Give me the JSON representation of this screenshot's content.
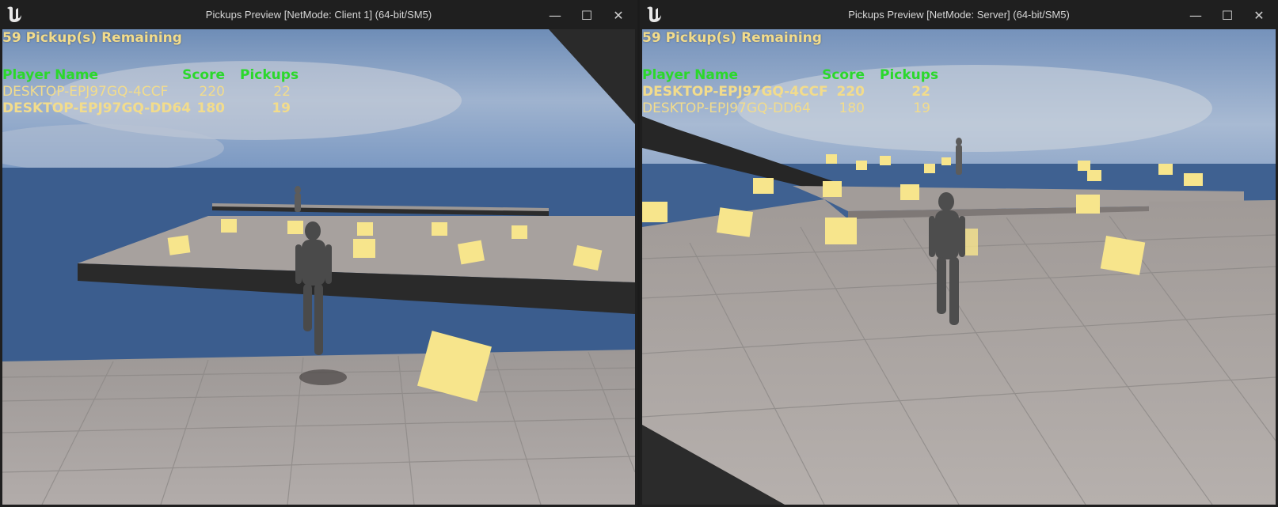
{
  "windows": [
    {
      "title": "Pickups Preview [NetMode: Client 1]  (64-bit/SM5)",
      "hud": {
        "remaining": "59 Pickup(s) Remaining",
        "headers": {
          "name": "Player Name",
          "score": "Score",
          "pickups": "Pickups"
        },
        "players": [
          {
            "name": "DESKTOP-EPJ97GQ-4CCF",
            "score": "220",
            "pickups": "22",
            "highlighted": false
          },
          {
            "name": "DESKTOP-EPJ97GQ-DD64",
            "score": "180",
            "pickups": "19",
            "highlighted": true
          }
        ]
      }
    },
    {
      "title": "Pickups Preview [NetMode: Server]  (64-bit/SM5)",
      "hud": {
        "remaining": "59 Pickup(s) Remaining",
        "headers": {
          "name": "Player Name",
          "score": "Score",
          "pickups": "Pickups"
        },
        "players": [
          {
            "name": "DESKTOP-EPJ97GQ-4CCF",
            "score": "220",
            "pickups": "22",
            "highlighted": true
          },
          {
            "name": "DESKTOP-EPJ97GQ-DD64",
            "score": "180",
            "pickups": "19",
            "highlighted": false
          }
        ]
      }
    }
  ],
  "window_controls": {
    "minimize": "—",
    "maximize": "☐",
    "close": "✕"
  },
  "colors": {
    "hud_text": "#f2dc8c",
    "hud_header": "#2bd82b",
    "pickup": "#f7e58c",
    "floor": "#a9a29f",
    "water": "#3b5d8e"
  },
  "icons": {
    "app": "unreal-engine-logo-icon",
    "minimize": "minimize-icon",
    "maximize": "maximize-icon",
    "close": "close-icon"
  }
}
